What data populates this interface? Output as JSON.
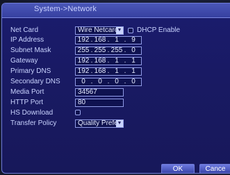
{
  "window": {
    "title": "System->Network"
  },
  "fields": {
    "net_card": {
      "label": "Net Card",
      "value": "Wire Netcarc"
    },
    "dhcp": {
      "label": "DHCP Enable"
    },
    "ip_address": {
      "label": "IP Address",
      "octets": [
        "192",
        "168",
        "1",
        "9"
      ]
    },
    "subnet_mask": {
      "label": "Subnet Mask",
      "octets": [
        "255",
        "255",
        "255",
        "0"
      ]
    },
    "gateway": {
      "label": "Gateway",
      "octets": [
        "192",
        "168",
        "1",
        "1"
      ]
    },
    "primary_dns": {
      "label": "Primary DNS",
      "octets": [
        "192",
        "168",
        "1",
        "1"
      ]
    },
    "secondary_dns": {
      "label": "Secondary DNS",
      "octets": [
        "0",
        "0",
        "0",
        "0"
      ]
    },
    "media_port": {
      "label": "Media Port",
      "value": "34567"
    },
    "http_port": {
      "label": "HTTP Port",
      "value": "80"
    },
    "hs_download": {
      "label": "HS Download"
    },
    "transfer_policy": {
      "label": "Transfer Policy",
      "value": "Quality Prefe"
    }
  },
  "separator": ".",
  "buttons": {
    "ok": "OK",
    "cancel": "Cance"
  }
}
